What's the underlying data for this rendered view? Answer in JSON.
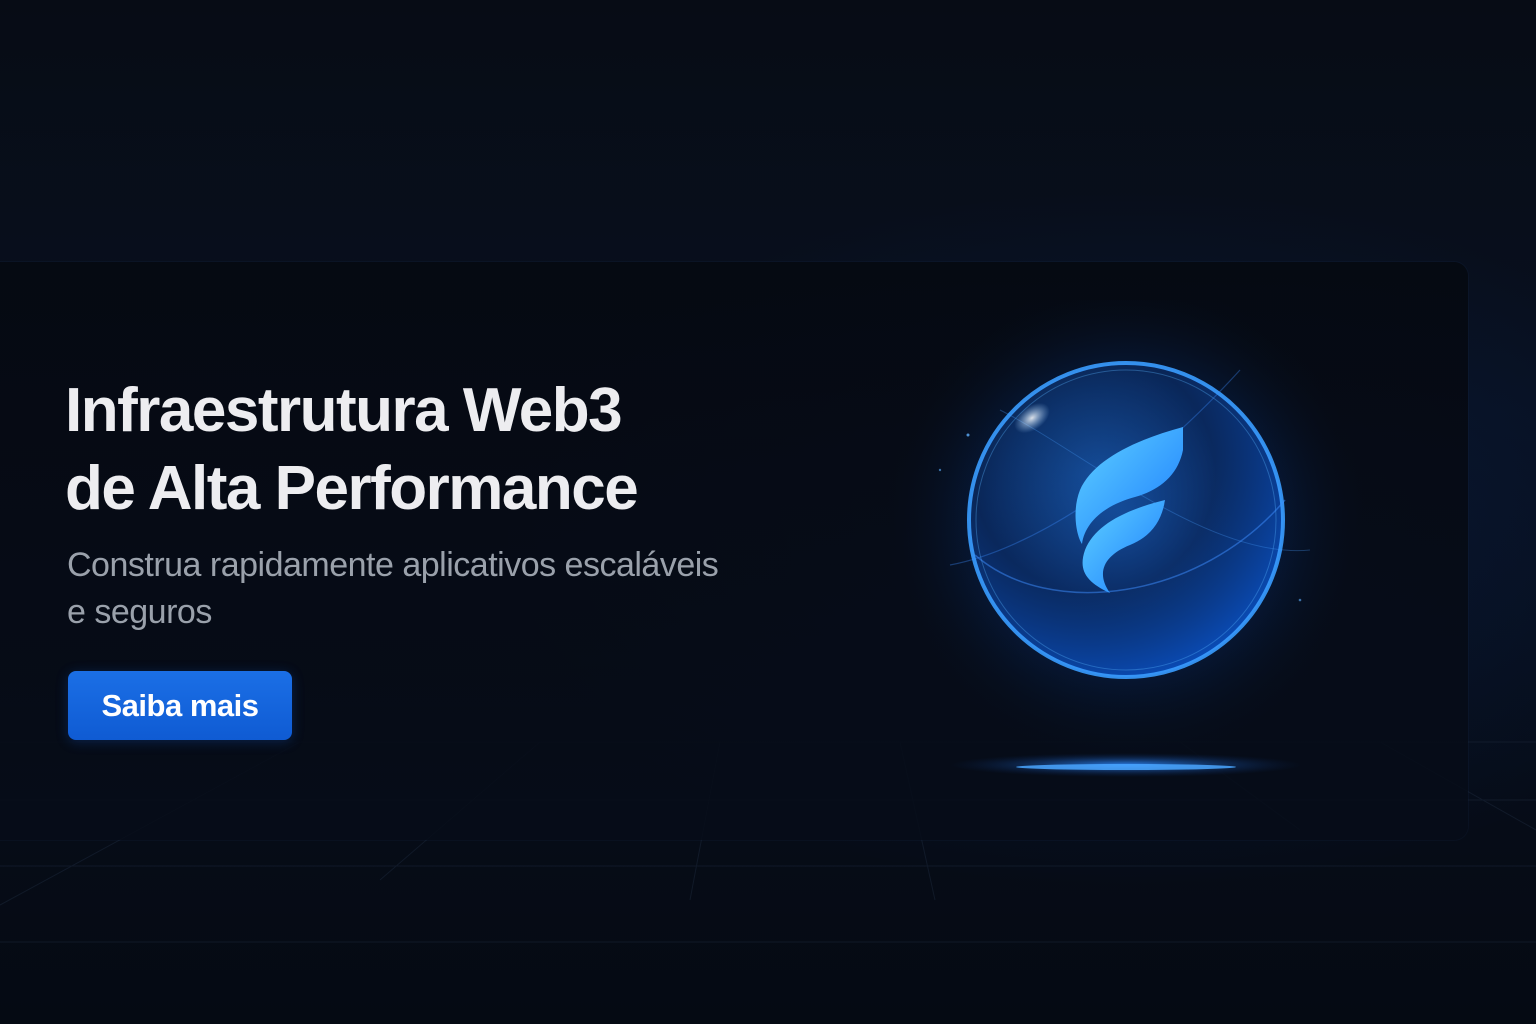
{
  "hero": {
    "title_line1": "Infraestrutura Web3",
    "title_line2": "de Alta Performance",
    "subtitle_line1": "Construa rapidamente aplicativos escaláveis",
    "subtitle_line2": "e seguros",
    "cta_label": "Saiba mais"
  },
  "logo": {
    "icon": "flame-f-logo-icon"
  },
  "colors": {
    "background": "#060b14",
    "accent": "#1565dc",
    "orb_glow": "#1e8bff",
    "title": "#ededf0",
    "subtitle": "#9aa1ab"
  }
}
